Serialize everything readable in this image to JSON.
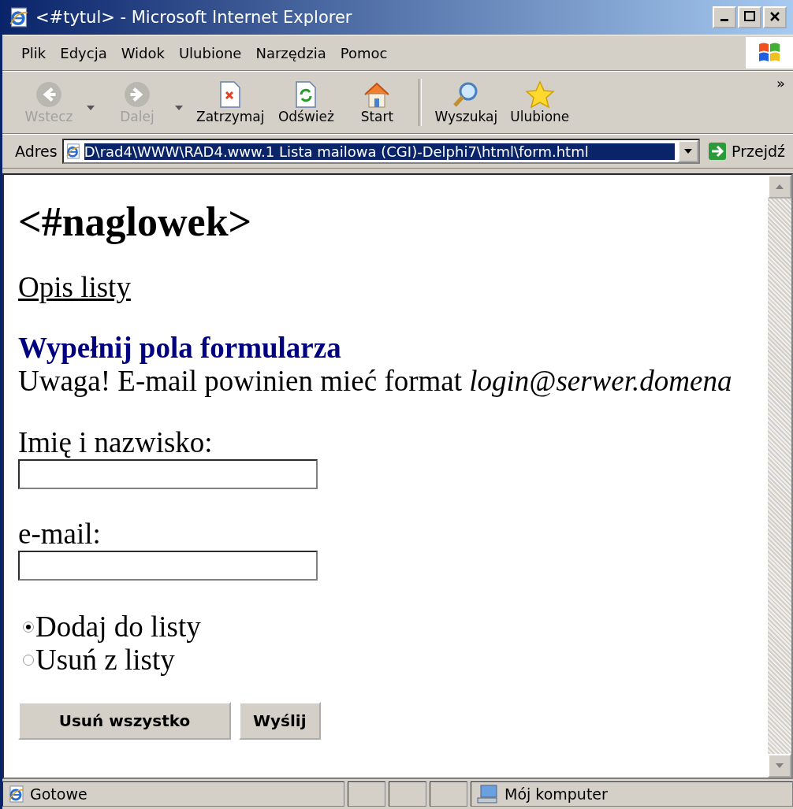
{
  "window": {
    "title": "<#tytul> - Microsoft Internet Explorer"
  },
  "menu": [
    {
      "label": "Plik"
    },
    {
      "label": "Edycja"
    },
    {
      "label": "Widok"
    },
    {
      "label": "Ulubione"
    },
    {
      "label": "Narzędzia"
    },
    {
      "label": "Pomoc"
    }
  ],
  "toolbar": {
    "buttons": [
      {
        "kind": "back",
        "label": "Wstecz",
        "disabled": true,
        "dropdown": true
      },
      {
        "kind": "forward",
        "label": "Dalej",
        "disabled": true,
        "dropdown": true
      },
      {
        "kind": "stop",
        "label": "Zatrzymaj",
        "disabled": false,
        "dropdown": false
      },
      {
        "kind": "refresh",
        "label": "Odśwież",
        "disabled": false,
        "dropdown": false
      },
      {
        "kind": "home",
        "label": "Start",
        "disabled": false,
        "dropdown": false
      },
      {
        "kind": "search",
        "label": "Wyszukaj",
        "disabled": false,
        "dropdown": false
      },
      {
        "kind": "favorites",
        "label": "Ulubione",
        "disabled": false,
        "dropdown": false
      }
    ],
    "more": "»"
  },
  "address": {
    "label": "Adres",
    "value": "D\\rad4\\WWW\\RAD4.www.1 Lista mailowa (CGI)-Delphi7\\html\\form.html",
    "go": "Przejdź"
  },
  "page": {
    "heading": "<#naglowek>",
    "link": "Opis listy",
    "form_title": "Wypełnij pola formularza",
    "note": "Uwaga! E-mail powinien mieć format *login@serwer.domena*",
    "fields": [
      {
        "label": "Imię i nazwisko:"
      },
      {
        "label": "e-mail:"
      }
    ],
    "radios": [
      {
        "label": "Dodaj do listy",
        "selected": true
      },
      {
        "label": "Usuń z listy",
        "selected": false
      }
    ],
    "buttons": [
      {
        "label": "Usuń wszystko"
      },
      {
        "label": "Wyślij"
      }
    ]
  },
  "status_bar": {
    "text": "Gotowe",
    "zone": "Mój komputer"
  }
}
